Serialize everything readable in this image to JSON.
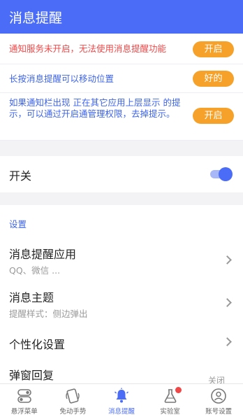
{
  "header": {
    "title": "消息提醒"
  },
  "notices": [
    {
      "text": "通知服务未开启，无法使用消息提醒功能",
      "button": "开启",
      "color": "#f04848"
    },
    {
      "text": "长按消息提醒可以移动位置",
      "button": "好的",
      "color": "#3e64e8"
    },
    {
      "text": "如果通知栏出现 正在其它应用上层显示 的提示，可以通过开启通管理权限，去掉提示。",
      "button": "开启",
      "color": "#3e64e8"
    }
  ],
  "switch_row": {
    "label": "开关",
    "on": true
  },
  "settings": {
    "section_title": "设置",
    "items": [
      {
        "title": "消息提醒应用",
        "subtitle": "QQ、微信 ..."
      },
      {
        "title": "消息主题",
        "subtitle": "提醒样式：侧边弹出"
      },
      {
        "title": "个性化设置"
      },
      {
        "title": "弹窗回复",
        "value": "关闭"
      }
    ]
  },
  "tabbar": {
    "tabs": [
      {
        "label": "悬浮菜单",
        "icon": "toggle-icon"
      },
      {
        "label": "免动手势",
        "icon": "phone-gesture-icon"
      },
      {
        "label": "消息提醒",
        "icon": "bell-icon",
        "active": true
      },
      {
        "label": "实验室",
        "icon": "flask-icon",
        "badge": true
      },
      {
        "label": "账号设置",
        "icon": "user-icon"
      }
    ]
  },
  "colors": {
    "accent": "#4a6cf7",
    "warning_button": "#f6a22a",
    "alert_text": "#f04848",
    "info_text": "#3e64e8"
  }
}
